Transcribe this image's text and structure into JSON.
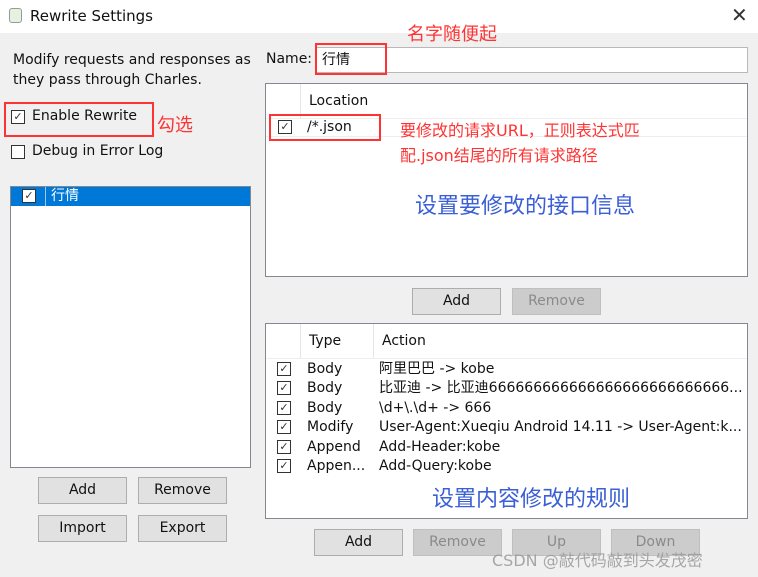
{
  "window": {
    "title": "Rewrite Settings",
    "close_icon": "close-icon"
  },
  "left": {
    "description": "Modify requests and responses as they pass through Charles.",
    "enable_rewrite": {
      "label": "Enable Rewrite",
      "checked": true
    },
    "debug": {
      "label": "Debug in Error Log",
      "checked": false
    },
    "sets": [
      {
        "name": "行情",
        "checked": true,
        "selected": true
      }
    ],
    "buttons": {
      "add": "Add",
      "remove": "Remove",
      "import": "Import",
      "export": "Export"
    }
  },
  "name": {
    "label": "Name:",
    "value": "行情"
  },
  "locations": {
    "header": "Location",
    "rows": [
      {
        "checked": true,
        "location": "/*.json"
      }
    ],
    "add": "Add",
    "remove": "Remove"
  },
  "rules": {
    "headers": {
      "type": "Type",
      "action": "Action"
    },
    "rows": [
      {
        "type": "Body",
        "action": "阿里巴巴 -> kobe"
      },
      {
        "type": "Body",
        "action": "比亚迪 -> 比亚迪666666666666666666666666666..."
      },
      {
        "type": "Body",
        "action": "\\d+\\.\\d+ -> 666"
      },
      {
        "type": "Modify",
        "action": "User-Agent:Xueqiu Android 14.11 -> User-Agent:k..."
      },
      {
        "type": "Append",
        "action": "Add-Header:kobe"
      },
      {
        "type": "Appen...",
        "action": "Add-Query:kobe"
      }
    ],
    "buttons": {
      "add": "Add",
      "remove": "Remove",
      "up": "Up",
      "down": "Down"
    }
  },
  "annotations": {
    "name_hint": "名字随便起",
    "check_hint": "勾选",
    "location_hint_1": "要修改的请求URL，正则表达式匹",
    "location_hint_2": "配.json结尾的所有请求路径",
    "location_title": "设置要修改的接口信息",
    "rules_title": "设置内容修改的规则"
  },
  "watermark": "CSDN @敲代码敲到头发茂密",
  "colors": {
    "annotation_red": "#ff3333",
    "annotation_blue": "#3a5fd6",
    "selection": "#0078d7"
  }
}
